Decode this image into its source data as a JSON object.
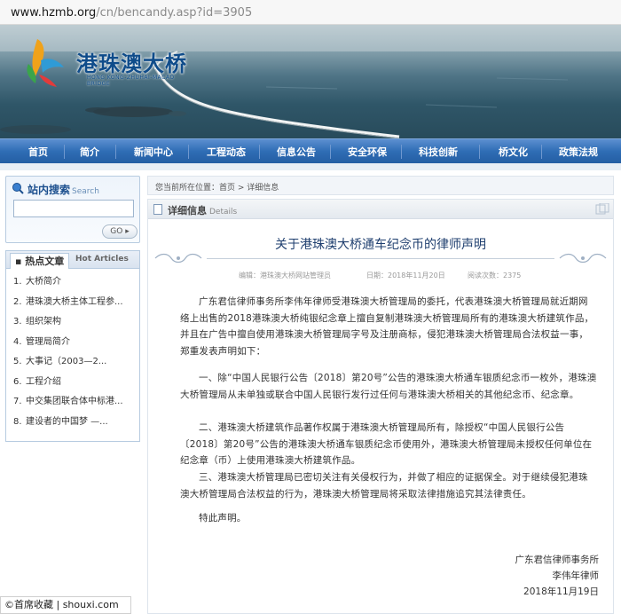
{
  "browser": {
    "url_host": "www.hzmb.org",
    "url_path": "/cn/bencandy.asp?id=3905"
  },
  "brand": {
    "logo_text": "港珠澳大桥",
    "logo_sub": "HONG KONG-ZHUHAI-MACAO BRIDGE"
  },
  "nav": {
    "items": [
      "首页",
      "简介",
      "新闻中心",
      "工程动态",
      "信息公告",
      "安全环保",
      "科技创新",
      "桥文化",
      "政策法规"
    ]
  },
  "sidebar": {
    "search_title": "站内搜索",
    "search_title_en": "Search",
    "search_value": "",
    "go_label": "GO",
    "hot_title": "热点文章",
    "hot_title_en": "Hot Articles",
    "hot_items": [
      {
        "num": "1.",
        "text": "大桥简介"
      },
      {
        "num": "2.",
        "text": "港珠澳大桥主体工程参..."
      },
      {
        "num": "3.",
        "text": "组织架构"
      },
      {
        "num": "4.",
        "text": "管理局简介"
      },
      {
        "num": "5.",
        "text": "大事记（2003—2..."
      },
      {
        "num": "6.",
        "text": "工程介绍"
      },
      {
        "num": "7.",
        "text": "中交集团联合体中标港..."
      },
      {
        "num": "8.",
        "text": "建设者的中国梦 —..."
      }
    ]
  },
  "breadcrumb": {
    "prefix": "您当前所在位置：",
    "home": "首页",
    "sep": " > ",
    "current": "详细信息"
  },
  "detail": {
    "header": "详细信息",
    "header_en": "Details",
    "title": "关于港珠澳大桥通车纪念币的律师声明",
    "editor": "编辑：港珠澳大桥网站管理员",
    "date": "日期：2018年11月20日",
    "views": "阅读次数：2375",
    "paragraphs": [
      "广东君信律师事务所李伟年律师受港珠澳大桥管理局的委托，代表港珠澳大桥管理局就近期网络上出售的2018港珠澳大桥纯银纪念章上擅自复制港珠澳大桥管理局所有的港珠澳大桥建筑作品，并且在广告中擅自使用港珠澳大桥管理局字号及注册商标，侵犯港珠澳大桥管理局合法权益一事，郑重发表声明如下：",
      "一、除“中国人民银行公告〔2018〕第20号”公告的港珠澳大桥通车银质纪念币一枚外，港珠澳大桥管理局从未单独或联合中国人民银行发行过任何与港珠澳大桥相关的其他纪念币、纪念章。",
      "二、港珠澳大桥建筑作品著作权属于港珠澳大桥管理局所有，除授权“中国人民银行公告〔2018〕第20号”公告的港珠澳大桥通车银质纪念币使用外，港珠澳大桥管理局未授权任何单位在纪念章（币）上使用港珠澳大桥建筑作品。",
      "三、港珠澳大桥管理局已密切关注有关侵权行为，并做了相应的证据保全。对于继续侵犯港珠澳大桥管理局合法权益的行为，港珠澳大桥管理局将采取法律措施追究其法律责任。",
      "特此声明。"
    ],
    "signature": [
      "广东君信律师事务所",
      "李伟年律师",
      "2018年11月19日"
    ]
  },
  "watermark": "©首席收藏 | shouxi.com",
  "colors": {
    "nav_blue": "#2f6db5",
    "title_blue": "#1f3f6f",
    "sidebar_border": "#b7cbe0"
  }
}
